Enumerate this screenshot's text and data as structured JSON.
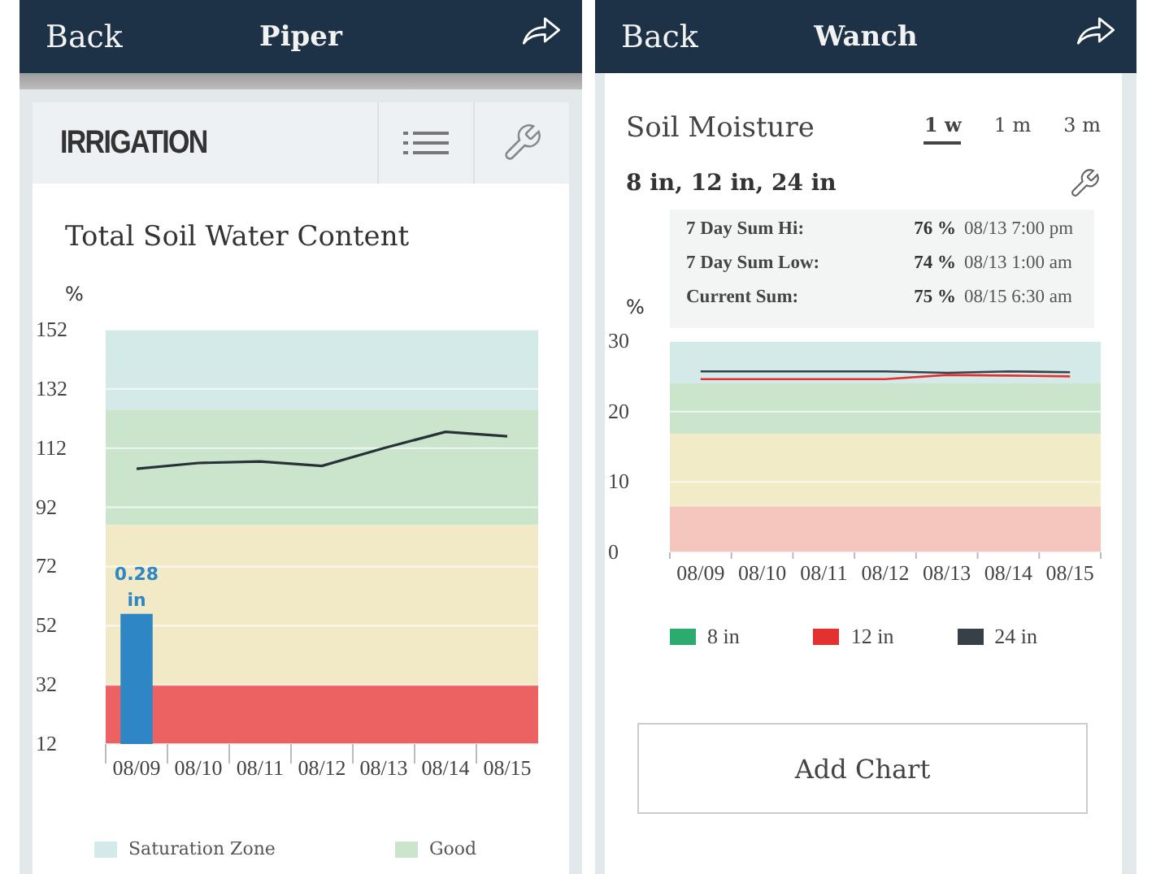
{
  "left_screen": {
    "header": {
      "back": "Back",
      "title": "Piper"
    },
    "card": {
      "title": "IRRIGATION",
      "chart_title": "Total Soil Water Content",
      "y_unit": "%",
      "chart_data": {
        "type": "line",
        "ylim": [
          12,
          152
        ],
        "categories": [
          "08/09",
          "08/10",
          "08/11",
          "08/12",
          "08/13",
          "08/14",
          "08/15"
        ],
        "series": [
          {
            "color": "#263238",
            "values": [
              105,
              107,
              107.5,
              106,
              112,
              117.5,
              116
            ]
          },
          {
            "type": "bar",
            "color": "#2f86c4",
            "values": [
              56,
              null,
              null,
              null,
              null,
              null,
              null
            ]
          }
        ],
        "yticks": [
          12,
          32,
          52,
          72,
          92,
          112,
          132,
          152
        ],
        "grid": true,
        "bands": [
          {
            "axis": "y",
            "from": 125,
            "to": 152,
            "color": "#d3eae8"
          },
          {
            "axis": "y",
            "from": 86,
            "to": 125,
            "color": "#cbe5cc"
          },
          {
            "axis": "y",
            "from": 32,
            "to": 86,
            "color": "#f2eac7"
          },
          {
            "axis": "y",
            "from": 12,
            "to": 32,
            "color": "#ec6161"
          }
        ],
        "annotations": [
          "0.28 in"
        ]
      },
      "legend": [
        {
          "label": "Saturation Zone",
          "color": "#d3eae8"
        },
        {
          "label": "Good",
          "color": "#cbe5cc"
        }
      ]
    }
  },
  "right_screen": {
    "header": {
      "back": "Back",
      "title": "Wanch"
    },
    "title": "Soil Moisture",
    "tabs": [
      {
        "label": "1 w",
        "selected": true
      },
      {
        "label": "1 m",
        "selected": false
      },
      {
        "label": "3 m",
        "selected": false
      }
    ],
    "depths": "8 in, 12 in, 24 in",
    "stats": [
      {
        "label": "7 Day Sum Hi:",
        "value": "76 %",
        "time": "08/13 7:00 pm"
      },
      {
        "label": "7 Day Sum Low:",
        "value": "74 %",
        "time": "08/13 1:00 am"
      },
      {
        "label": "Current Sum:",
        "value": "75 %",
        "time": "08/15 6:30 am"
      }
    ],
    "y_unit": "%",
    "chart_data": {
      "type": "line",
      "ylim": [
        0,
        30
      ],
      "categories": [
        "08/09",
        "08/10",
        "08/11",
        "08/12",
        "08/13",
        "08/14",
        "08/15"
      ],
      "series": [
        {
          "color": "#e53030",
          "values": [
            24.6,
            24.6,
            24.6,
            24.6,
            25.2,
            25.1,
            25.0
          ]
        },
        {
          "color": "#373f47",
          "values": [
            25.7,
            25.7,
            25.7,
            25.7,
            25.5,
            25.7,
            25.6
          ]
        }
      ],
      "yticks": [
        0,
        10,
        20,
        30
      ],
      "grid": true,
      "bands": [
        {
          "axis": "y",
          "from": 24,
          "to": 30,
          "color": "#d3eae8"
        },
        {
          "axis": "y",
          "from": 16.8,
          "to": 24,
          "color": "#cbe5cc"
        },
        {
          "axis": "y",
          "from": 6.5,
          "to": 16.8,
          "color": "#f2ebc8"
        },
        {
          "axis": "y",
          "from": 0,
          "to": 6.5,
          "color": "#f4c6be"
        }
      ]
    },
    "legend": [
      {
        "label": "8 in",
        "color": "#2bab6e"
      },
      {
        "label": "12 in",
        "color": "#e53030"
      },
      {
        "label": "24 in",
        "color": "#373f47"
      }
    ],
    "button": "Add Chart"
  }
}
